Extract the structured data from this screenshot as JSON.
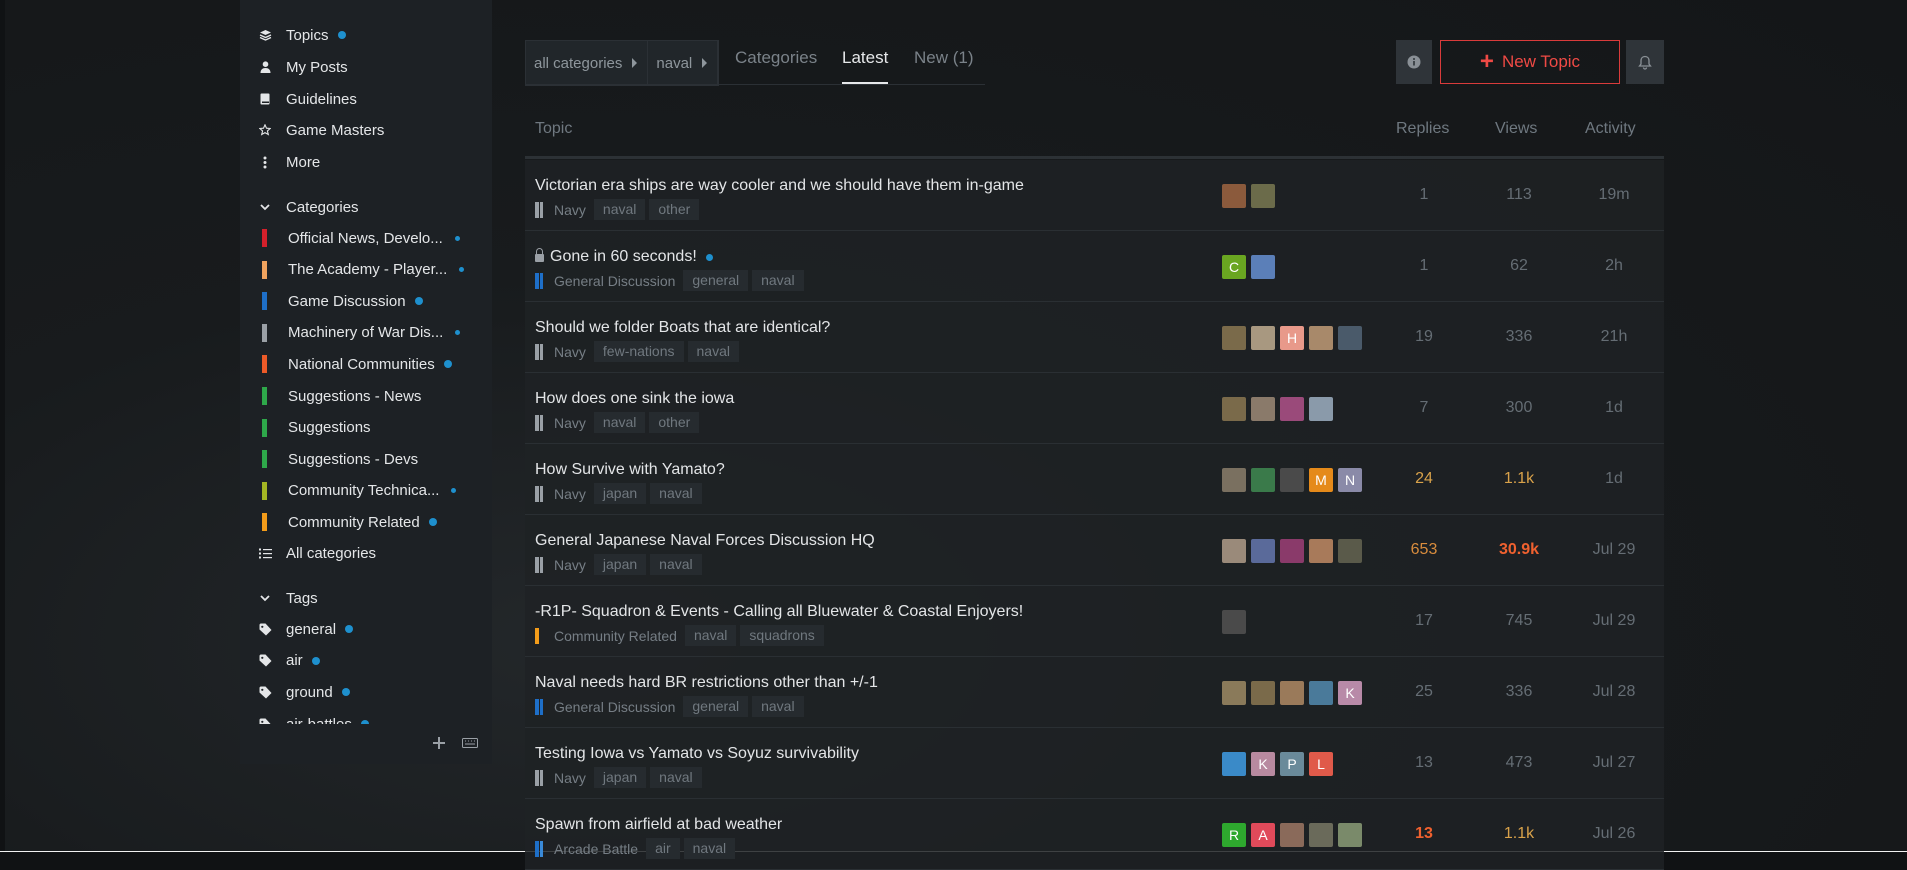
{
  "sidebar": {
    "nav": [
      {
        "label": "Topics",
        "icon": "layers-icon",
        "dot": true
      },
      {
        "label": "My Posts",
        "icon": "user-icon",
        "dot": false
      },
      {
        "label": "Guidelines",
        "icon": "book-icon",
        "dot": false
      },
      {
        "label": "Game Masters",
        "icon": "star-icon",
        "dot": false
      },
      {
        "label": "More",
        "icon": "vertical-ellipsis-icon",
        "dot": false
      }
    ],
    "categories_heading": "Categories",
    "categories": [
      {
        "label": "Official News, Develo...",
        "color": "#d4202b",
        "dot": true
      },
      {
        "label": "The Academy - Player...",
        "color": "#f0a35e",
        "dot": true
      },
      {
        "label": "Game Discussion",
        "color": "#1e6fc8",
        "dot": true
      },
      {
        "label": "Machinery of War Dis...",
        "color": "#9aa0a6",
        "dot": true
      },
      {
        "label": "National Communities",
        "color": "#ec5a28",
        "dot": true
      },
      {
        "label": "Suggestions - News",
        "color": "#2ea84a",
        "dot": false
      },
      {
        "label": "Suggestions",
        "color": "#2ea84a",
        "dot": false
      },
      {
        "label": "Suggestions - Devs",
        "color": "#2ea84a",
        "dot": false
      },
      {
        "label": "Community Technica...",
        "color": "#a4b623",
        "dot": true
      },
      {
        "label": "Community Related",
        "color": "#f39c1a",
        "dot": true
      }
    ],
    "all_categories": "All categories",
    "tags_heading": "Tags",
    "tags": [
      {
        "label": "general",
        "dot": true
      },
      {
        "label": "air",
        "dot": true
      },
      {
        "label": "ground",
        "dot": true
      },
      {
        "label": "air-battles",
        "dot": true
      }
    ]
  },
  "nav": {
    "breadcrumbs": [
      "all categories",
      "naval"
    ],
    "tabs": [
      "Categories",
      "Latest",
      "New (1)"
    ],
    "active_tab": "Latest",
    "new_topic": "New Topic"
  },
  "table": {
    "headers": {
      "topic": "Topic",
      "replies": "Replies",
      "views": "Views",
      "activity": "Activity"
    },
    "rows": [
      {
        "title": "Victorian era ships are way cooler and we should have them in-game",
        "locked": false,
        "unread": false,
        "category": "Navy",
        "cat_colors": [
          "#9aa0a6",
          "#9aa0a6"
        ],
        "tags": [
          "naval",
          "other"
        ],
        "posters": [
          {
            "bg": "#8b5a3c"
          },
          {
            "bg": "#6b6b4a"
          }
        ],
        "replies": "1",
        "views": "113",
        "activity": "19m",
        "replies_style": "",
        "views_style": ""
      },
      {
        "title": "Gone in 60 seconds!",
        "locked": true,
        "unread": true,
        "category": "General Discussion",
        "cat_colors": [
          "#1e6fc8",
          "#1e6fc8"
        ],
        "tags": [
          "general",
          "naval"
        ],
        "posters": [
          {
            "bg": "#6aa621",
            "letter": "C"
          },
          {
            "bg": "#5b7fb8"
          }
        ],
        "replies": "1",
        "views": "62",
        "activity": "2h",
        "replies_style": "",
        "views_style": ""
      },
      {
        "title": "Should we folder Boats that are identical?",
        "locked": false,
        "unread": false,
        "category": "Navy",
        "cat_colors": [
          "#9aa0a6",
          "#9aa0a6"
        ],
        "tags": [
          "few-nations",
          "naval"
        ],
        "posters": [
          {
            "bg": "#7a6a4a"
          },
          {
            "bg": "#a89880"
          },
          {
            "bg": "#e8998a",
            "letter": "H"
          },
          {
            "bg": "#a8896a"
          },
          {
            "bg": "#4a5a6a"
          }
        ],
        "replies": "19",
        "views": "336",
        "activity": "21h",
        "replies_style": "",
        "views_style": ""
      },
      {
        "title": "How does one sink the iowa",
        "locked": false,
        "unread": false,
        "category": "Navy",
        "cat_colors": [
          "#9aa0a6",
          "#9aa0a6"
        ],
        "tags": [
          "naval",
          "other"
        ],
        "posters": [
          {
            "bg": "#7a6a4a"
          },
          {
            "bg": "#8a7a6a"
          },
          {
            "bg": "#9a4a7a"
          },
          {
            "bg": "#8a9aaa"
          }
        ],
        "replies": "7",
        "views": "300",
        "activity": "1d",
        "replies_style": "",
        "views_style": ""
      },
      {
        "title": "How Survive with Yamato?",
        "locked": false,
        "unread": false,
        "category": "Navy",
        "cat_colors": [
          "#9aa0a6",
          "#9aa0a6"
        ],
        "tags": [
          "japan",
          "naval"
        ],
        "posters": [
          {
            "bg": "#7a7060"
          },
          {
            "bg": "#3a7a4a"
          },
          {
            "bg": "#4a4a4a"
          },
          {
            "bg": "#e58a1a",
            "letter": "M"
          },
          {
            "bg": "#8a8aa8",
            "letter": "N"
          }
        ],
        "replies": "24",
        "views": "1.1k",
        "activity": "1d",
        "replies_style": "warm",
        "views_style": "warm"
      },
      {
        "title": "General Japanese Naval Forces Discussion HQ",
        "locked": false,
        "unread": false,
        "category": "Navy",
        "cat_colors": [
          "#9aa0a6",
          "#9aa0a6"
        ],
        "tags": [
          "japan",
          "naval"
        ],
        "posters": [
          {
            "bg": "#9a8a7a"
          },
          {
            "bg": "#5a6a9a"
          },
          {
            "bg": "#8a3a6a"
          },
          {
            "bg": "#a87a5a"
          },
          {
            "bg": "#5a5a4a"
          }
        ],
        "replies": "653",
        "views": "30.9k",
        "activity": "Jul 29",
        "replies_style": "hot1",
        "views_style": "hot2"
      },
      {
        "title": "-R1P- Squadron & Events - Calling all Bluewater & Coastal Enjoyers!",
        "locked": false,
        "unread": false,
        "category": "Community Related",
        "cat_colors": [
          "#f39c1a"
        ],
        "tags": [
          "naval",
          "squadrons"
        ],
        "posters": [
          {
            "bg": "#4a4a4a"
          }
        ],
        "replies": "17",
        "views": "745",
        "activity": "Jul 29",
        "replies_style": "",
        "views_style": ""
      },
      {
        "title": "Naval needs hard BR restrictions other than +/-1",
        "locked": false,
        "unread": false,
        "category": "General Discussion",
        "cat_colors": [
          "#1e6fc8",
          "#1e6fc8"
        ],
        "tags": [
          "general",
          "naval"
        ],
        "posters": [
          {
            "bg": "#8a7a5a"
          },
          {
            "bg": "#7a6a4a"
          },
          {
            "bg": "#9a7a5a"
          },
          {
            "bg": "#4a7a9a"
          },
          {
            "bg": "#b88aa8",
            "letter": "K"
          }
        ],
        "replies": "25",
        "views": "336",
        "activity": "Jul 28",
        "replies_style": "",
        "views_style": ""
      },
      {
        "title": "Testing Iowa vs Yamato vs Soyuz survivability",
        "locked": false,
        "unread": false,
        "category": "Navy",
        "cat_colors": [
          "#9aa0a6",
          "#9aa0a6"
        ],
        "tags": [
          "japan",
          "naval"
        ],
        "posters": [
          {
            "bg": "#3a8ac8"
          },
          {
            "bg": "#b88aa0",
            "letter": "K"
          },
          {
            "bg": "#6a8a9a",
            "letter": "P"
          },
          {
            "bg": "#e05a4a",
            "letter": "L"
          }
        ],
        "replies": "13",
        "views": "473",
        "activity": "Jul 27",
        "replies_style": "",
        "views_style": ""
      },
      {
        "title": "Spawn from airfield at bad weather",
        "locked": false,
        "unread": false,
        "category": "Arcade Battle",
        "cat_colors": [
          "#1e6fc8",
          "#3a8ad8"
        ],
        "tags": [
          "air",
          "naval"
        ],
        "posters": [
          {
            "bg": "#2ea82e",
            "letter": "R"
          },
          {
            "bg": "#e04a5a",
            "letter": "A"
          },
          {
            "bg": "#8a6a5a"
          },
          {
            "bg": "#6a6a5a"
          },
          {
            "bg": "#7a8a6a"
          }
        ],
        "replies": "13",
        "views": "1.1k",
        "activity": "Jul 26",
        "replies_style": "hot2",
        "views_style": "warm"
      }
    ]
  },
  "colors": {
    "accent": "#ef4a45",
    "unread_dot": "#1e90ce",
    "background": "#141618"
  }
}
